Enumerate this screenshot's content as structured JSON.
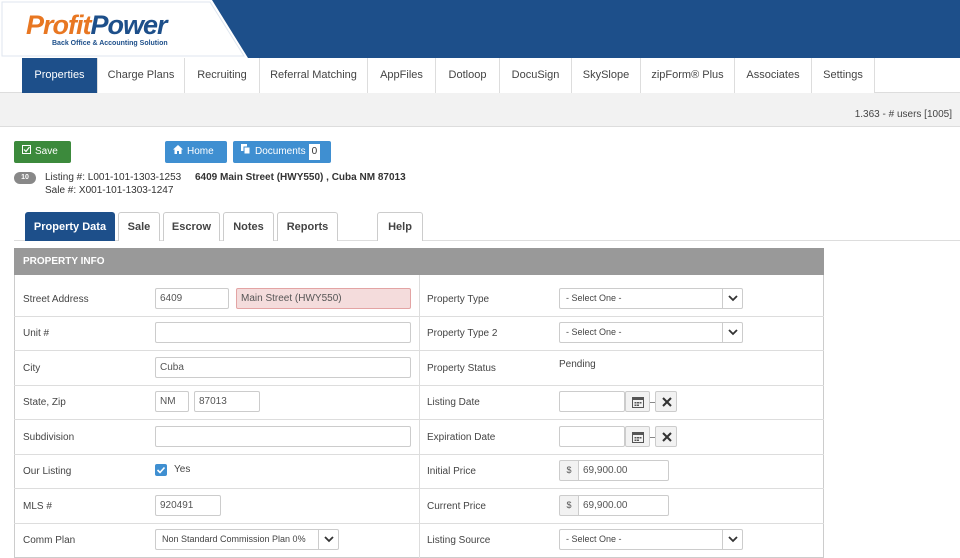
{
  "brand": {
    "name_part1": "Profit",
    "name_part2": "Power",
    "tagline": "Back Office & Accounting Solution"
  },
  "nav": {
    "items": [
      {
        "label": "Properties"
      },
      {
        "label": "Charge Plans"
      },
      {
        "label": "Recruiting"
      },
      {
        "label": "Referral Matching"
      },
      {
        "label": "AppFiles"
      },
      {
        "label": "Dotloop"
      },
      {
        "label": "DocuSign"
      },
      {
        "label": "SkySlope"
      },
      {
        "label": "zipForm® Plus"
      },
      {
        "label": "Associates"
      },
      {
        "label": "Settings"
      }
    ],
    "active": "Properties"
  },
  "status": {
    "users": "1.363 - # users [1005]"
  },
  "toolbar": {
    "save_label": "Save",
    "home_label": "Home",
    "documents_label": "Documents",
    "documents_count": "0"
  },
  "record": {
    "badge": "10",
    "listing_no": "Listing #: L001-101-1303-1253",
    "sale_no": "Sale #: X001-101-1303-1247",
    "address": "6409 Main Street (HWY550) , Cuba NM 87013"
  },
  "tabs": [
    {
      "label": "Property Data"
    },
    {
      "label": "Sale"
    },
    {
      "label": "Escrow"
    },
    {
      "label": "Notes"
    },
    {
      "label": "Reports"
    },
    {
      "label": "Help"
    }
  ],
  "section": {
    "title": "PROPERTY INFO",
    "left": {
      "street_address_label": "Street Address",
      "street_number": "6409",
      "street_name": "Main Street (HWY550)",
      "unit_label": "Unit #",
      "unit_value": "",
      "city_label": "City",
      "city_value": "Cuba",
      "state_zip_label": "State, Zip",
      "state_value": "NM",
      "zip_value": "87013",
      "subdivision_label": "Subdivision",
      "subdivision_value": "",
      "our_listing_label": "Our Listing",
      "our_listing_value": "Yes",
      "mls_label": "MLS #",
      "mls_value": "920491",
      "comm_plan_label": "Comm Plan",
      "comm_plan_value": "Non Standard Commission Plan 0%"
    },
    "right": {
      "property_type_label": "Property Type",
      "property_type_value": "- Select One -",
      "property_type2_label": "Property Type 2",
      "property_type2_value": "- Select One -",
      "property_status_label": "Property Status",
      "property_status_value": "Pending",
      "listing_date_label": "Listing Date",
      "listing_date_value": "",
      "expiration_date_label": "Expiration Date",
      "expiration_date_value": "",
      "initial_price_label": "Initial Price",
      "initial_price_value": "69,900.00",
      "current_price_label": "Current Price",
      "current_price_value": "69,900.00",
      "currency_symbol": "$",
      "listing_source_label": "Listing Source",
      "listing_source_value": "- Select One -"
    }
  },
  "colors": {
    "brand_blue": "#1d4f8a",
    "brand_orange": "#e87722",
    "save_green": "#3c8a3c",
    "button_blue": "#3f8fd1"
  }
}
